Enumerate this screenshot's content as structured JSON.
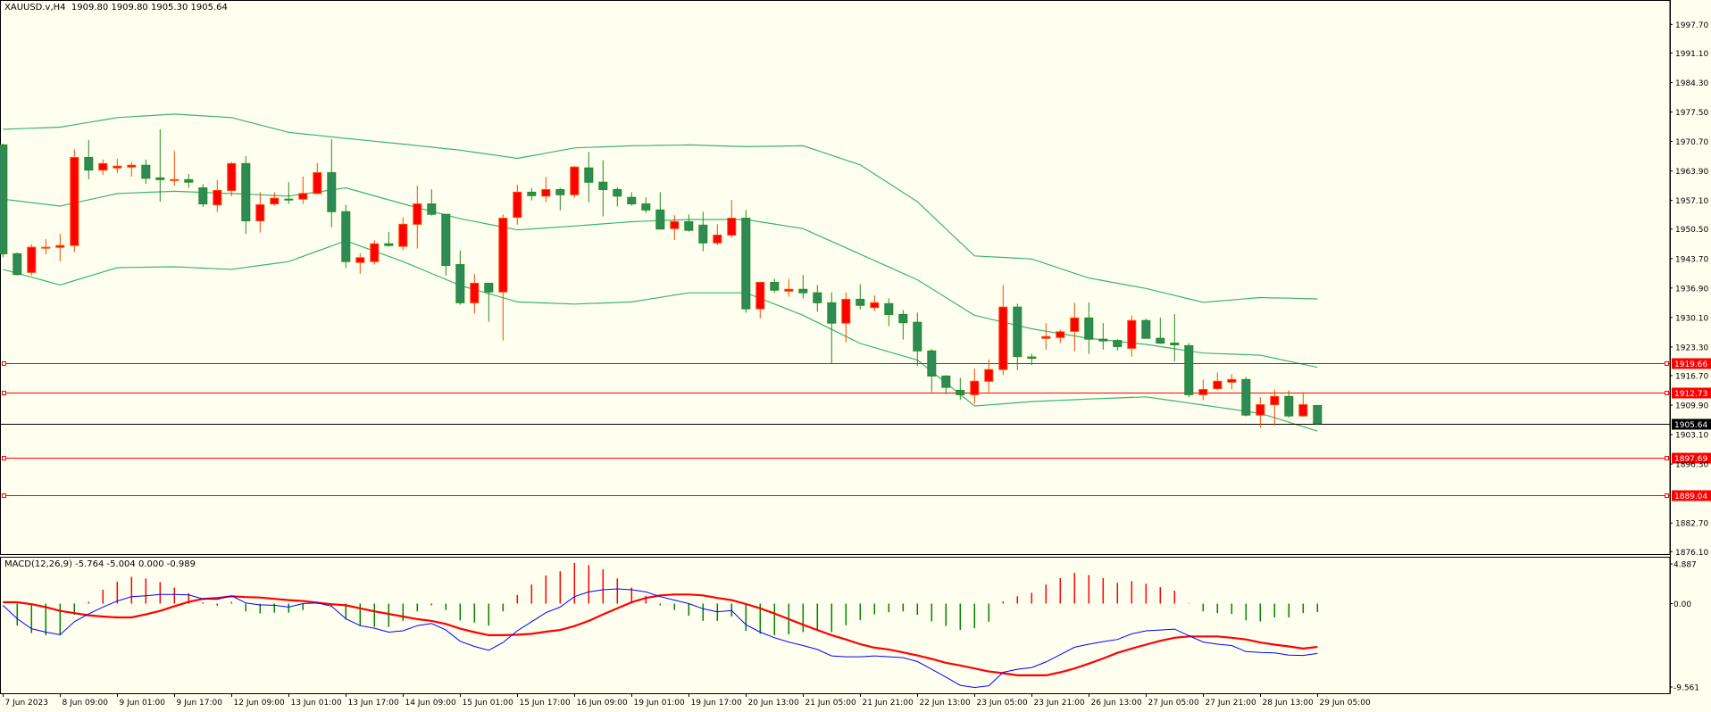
{
  "header": {
    "symbol": "XAUUSD.v,H4",
    "ohlc_text": "1909.80 1909.80 1905.30 1905.64"
  },
  "macd_panel": {
    "label": "MACD(12,26,9) -5.764 -5.004 0.000 -0.989"
  },
  "colors": {
    "background": "#FFFFF0",
    "bull_body": "#FF0000",
    "bull_border": "#FF4500",
    "bear_body": "#2E8B57",
    "bear_border": "#228B22",
    "bands": "#3CB371",
    "hline": "#FF0000",
    "price_line": "#000000",
    "macd_line": "#0000FF",
    "signal_line": "#FF0000",
    "hist_pos": "#FF0000",
    "hist_neg": "#008000"
  },
  "chart_data": [
    {
      "type": "candlestick",
      "title": "XAUUSD.v,H4",
      "timeframe": "H4",
      "ylim": [
        1874.5,
        2002.0
      ],
      "y_ticks": [
        "1997.70",
        "1991.10",
        "1984.30",
        "1977.50",
        "1970.70",
        "1963.90",
        "1957.10",
        "1950.50",
        "1943.70",
        "1936.90",
        "1930.10",
        "1923.30",
        "1916.70",
        "1909.90",
        "1903.10",
        "1896.30",
        "1882.70",
        "1876.10"
      ],
      "x_tick_labels": [
        "7 Jun 2023",
        "8 Jun 09:00",
        "9 Jun 01:00",
        "9 Jun 17:00",
        "12 Jun 09:00",
        "13 Jun 01:00",
        "13 Jun 17:00",
        "14 Jun 09:00",
        "15 Jun 01:00",
        "15 Jun 17:00",
        "16 Jun 09:00",
        "19 Jun 01:00",
        "19 Jun 17:00",
        "20 Jun 13:00",
        "21 Jun 05:00",
        "21 Jun 21:00",
        "22 Jun 13:00",
        "23 Jun 05:00",
        "23 Jun 21:00",
        "26 Jun 13:00",
        "27 Jun 05:00",
        "27 Jun 21:00",
        "28 Jun 13:00",
        "29 Jun 05:00"
      ],
      "x_tick_every_n_bars": 4,
      "ohlc": [
        [
          1969.9,
          1970.2,
          1944.0,
          1944.8
        ],
        [
          1944.8,
          1945.1,
          1939.8,
          1940.0
        ],
        [
          1940.5,
          1947.0,
          1939.8,
          1946.3
        ],
        [
          1946.2,
          1948.2,
          1944.7,
          1946.3
        ],
        [
          1946.3,
          1949.4,
          1943.1,
          1946.7
        ],
        [
          1946.7,
          1968.9,
          1945.2,
          1967.0
        ],
        [
          1967.0,
          1971.0,
          1962.0,
          1964.1
        ],
        [
          1964.1,
          1966.5,
          1963.0,
          1965.6
        ],
        [
          1964.6,
          1966.7,
          1963.4,
          1965.0
        ],
        [
          1964.8,
          1965.9,
          1962.6,
          1965.2
        ],
        [
          1965.2,
          1966.5,
          1960.9,
          1962.2
        ],
        [
          1962.3,
          1973.5,
          1956.8,
          1961.9
        ],
        [
          1961.8,
          1968.5,
          1960.5,
          1961.9
        ],
        [
          1961.9,
          1963.2,
          1960.0,
          1961.3
        ],
        [
          1960.0,
          1960.9,
          1955.6,
          1956.3
        ],
        [
          1956.1,
          1961.8,
          1954.4,
          1959.4
        ],
        [
          1959.4,
          1966.0,
          1958.1,
          1965.6
        ],
        [
          1965.6,
          1967.3,
          1949.4,
          1952.4
        ],
        [
          1952.4,
          1959.0,
          1949.7,
          1956.1
        ],
        [
          1956.3,
          1959.0,
          1955.9,
          1957.6
        ],
        [
          1957.4,
          1961.3,
          1956.3,
          1957.3
        ],
        [
          1957.4,
          1962.6,
          1956.3,
          1958.7
        ],
        [
          1958.7,
          1965.7,
          1958.5,
          1963.5
        ],
        [
          1963.5,
          1971.2,
          1950.9,
          1954.5
        ],
        [
          1954.5,
          1956.1,
          1941.5,
          1943.0
        ],
        [
          1942.8,
          1944.9,
          1940.2,
          1943.9
        ],
        [
          1943.0,
          1947.9,
          1942.3,
          1947.1
        ],
        [
          1947.1,
          1949.8,
          1946.4,
          1946.7
        ],
        [
          1946.5,
          1953.2,
          1945.6,
          1951.6
        ],
        [
          1951.6,
          1960.5,
          1946.0,
          1956.3
        ],
        [
          1956.3,
          1959.7,
          1953.6,
          1953.9
        ],
        [
          1953.9,
          1953.9,
          1939.8,
          1942.1
        ],
        [
          1942.3,
          1945.6,
          1933.0,
          1933.5
        ],
        [
          1933.5,
          1940.1,
          1931.0,
          1938.0
        ],
        [
          1938.0,
          1938.0,
          1929.1,
          1936.0
        ],
        [
          1936.0,
          1953.9,
          1924.8,
          1953.0
        ],
        [
          1953.2,
          1960.7,
          1951.5,
          1959.0
        ],
        [
          1959.0,
          1960.0,
          1957.1,
          1958.2
        ],
        [
          1958.1,
          1962.5,
          1956.7,
          1959.6
        ],
        [
          1959.6,
          1960.0,
          1954.8,
          1958.4
        ],
        [
          1958.4,
          1965.0,
          1957.7,
          1964.8
        ],
        [
          1964.6,
          1968.3,
          1956.7,
          1961.3
        ],
        [
          1961.3,
          1966.4,
          1953.4,
          1959.6
        ],
        [
          1959.6,
          1960.1,
          1955.7,
          1958.1
        ],
        [
          1957.8,
          1959.0,
          1955.9,
          1956.3
        ],
        [
          1956.3,
          1957.8,
          1954.2,
          1954.9
        ],
        [
          1954.9,
          1959.0,
          1950.4,
          1950.5
        ],
        [
          1950.6,
          1953.7,
          1948.0,
          1952.2
        ],
        [
          1952.2,
          1953.9,
          1949.9,
          1950.2
        ],
        [
          1951.4,
          1954.5,
          1945.4,
          1947.3
        ],
        [
          1947.3,
          1951.6,
          1946.8,
          1949.1
        ],
        [
          1949.1,
          1957.2,
          1948.5,
          1953.0
        ],
        [
          1953.0,
          1954.9,
          1931.2,
          1932.1
        ],
        [
          1932.1,
          1938.4,
          1929.9,
          1938.2
        ],
        [
          1938.2,
          1939.0,
          1935.8,
          1936.4
        ],
        [
          1936.2,
          1939.0,
          1934.9,
          1936.6
        ],
        [
          1936.6,
          1939.9,
          1934.5,
          1935.8
        ],
        [
          1935.8,
          1937.6,
          1931.4,
          1933.5
        ],
        [
          1933.5,
          1935.9,
          1919.5,
          1928.8
        ],
        [
          1928.8,
          1935.9,
          1924.4,
          1934.3
        ],
        [
          1934.3,
          1937.8,
          1932.0,
          1932.9
        ],
        [
          1932.4,
          1935.2,
          1931.6,
          1933.5
        ],
        [
          1933.3,
          1934.5,
          1928.1,
          1930.8
        ],
        [
          1930.8,
          1931.8,
          1925.0,
          1928.9
        ],
        [
          1929.0,
          1931.2,
          1918.9,
          1922.4
        ],
        [
          1922.4,
          1922.8,
          1912.9,
          1916.6
        ],
        [
          1916.6,
          1916.8,
          1912.4,
          1914.0
        ],
        [
          1913.3,
          1916.2,
          1911.1,
          1912.3
        ],
        [
          1912.3,
          1918.3,
          1910.2,
          1915.4
        ],
        [
          1915.4,
          1920.4,
          1912.9,
          1918.1
        ],
        [
          1918.1,
          1937.6,
          1916.8,
          1932.5
        ],
        [
          1932.5,
          1933.3,
          1918.0,
          1921.1
        ],
        [
          1921.0,
          1921.8,
          1919.1,
          1920.7
        ],
        [
          1925.3,
          1928.8,
          1922.7,
          1925.7
        ],
        [
          1925.5,
          1927.3,
          1924.2,
          1926.8
        ],
        [
          1926.9,
          1933.5,
          1922.3,
          1930.0
        ],
        [
          1930.0,
          1933.6,
          1921.7,
          1925.1
        ],
        [
          1925.1,
          1928.8,
          1922.7,
          1924.7
        ],
        [
          1924.8,
          1925.1,
          1922.5,
          1923.4
        ],
        [
          1923.0,
          1930.6,
          1921.1,
          1929.4
        ],
        [
          1929.4,
          1929.9,
          1925.3,
          1925.3
        ],
        [
          1925.3,
          1930.1,
          1924.0,
          1924.2
        ],
        [
          1924.2,
          1930.9,
          1920.0,
          1923.8
        ],
        [
          1923.6,
          1924.2,
          1911.7,
          1912.3
        ],
        [
          1912.3,
          1915.8,
          1911.0,
          1913.5
        ],
        [
          1913.7,
          1917.4,
          1913.3,
          1915.4
        ],
        [
          1915.2,
          1917.0,
          1913.5,
          1915.8
        ],
        [
          1915.8,
          1916.4,
          1907.3,
          1907.6
        ],
        [
          1907.6,
          1911.7,
          1904.7,
          1910.0
        ],
        [
          1910.0,
          1913.5,
          1905.2,
          1911.9
        ],
        [
          1911.9,
          1913.3,
          1907.0,
          1907.4
        ],
        [
          1907.4,
          1912.9,
          1907.2,
          1910.0
        ],
        [
          1909.8,
          1909.8,
          1905.3,
          1905.64
        ]
      ],
      "bollinger": {
        "sample_bars": [
          0,
          4,
          8,
          12,
          16,
          20,
          24,
          28,
          32,
          36,
          40,
          44,
          48,
          52,
          56,
          60,
          64,
          68,
          72,
          76,
          80,
          84,
          88,
          92
        ],
        "upper": [
          1973.5,
          1974.0,
          1976.2,
          1977.0,
          1976.2,
          1972.8,
          1971.4,
          1970.1,
          1968.7,
          1966.8,
          1969.2,
          1969.7,
          1969.9,
          1969.5,
          1969.7,
          1965.3,
          1956.8,
          1944.3,
          1943.6,
          1939.2,
          1936.8,
          1933.6,
          1934.7,
          1934.4
        ],
        "middle": [
          1957.4,
          1955.8,
          1958.7,
          1959.2,
          1958.7,
          1958.1,
          1960.0,
          1956.3,
          1952.9,
          1950.3,
          1951.2,
          1952.2,
          1952.7,
          1952.7,
          1950.6,
          1944.7,
          1938.8,
          1930.6,
          1927.5,
          1925.3,
          1923.9,
          1921.9,
          1921.4,
          1918.6
        ],
        "lower": [
          1941.2,
          1937.6,
          1941.6,
          1941.8,
          1941.2,
          1943.0,
          1947.8,
          1943.0,
          1937.5,
          1933.7,
          1933.2,
          1933.7,
          1935.8,
          1935.8,
          1930.6,
          1924.1,
          1920.3,
          1909.7,
          1910.7,
          1911.3,
          1911.8,
          1909.9,
          1908.0,
          1903.9
        ]
      },
      "horizontal_lines": [
        {
          "price": "1919.66",
          "type": "level"
        },
        {
          "price": "1912.73",
          "type": "level"
        },
        {
          "price": "1897.69",
          "type": "level"
        },
        {
          "price": "1889.04",
          "type": "level"
        }
      ],
      "current_price": "1905.64"
    },
    {
      "type": "macd",
      "title": "MACD(12,26,9)",
      "ylim": [
        -9.561,
        4.887
      ],
      "y_ticks": [
        "4.887",
        "0.00",
        "-9.561"
      ],
      "histogram": [
        0,
        -2.55,
        -3.4,
        -3.65,
        -3.65,
        -1.3,
        0.2,
        1.6,
        2.55,
        3.1,
        2.9,
        2.5,
        1.85,
        1.2,
        0.15,
        -0.25,
        0.2,
        -0.9,
        -1.15,
        -1.05,
        -1.05,
        -0.75,
        -0.03,
        -0.4,
        -1.85,
        -2.6,
        -2.7,
        -2.7,
        -2.0,
        -0.9,
        -0.2,
        -0.75,
        -1.95,
        -2.2,
        -2.55,
        -0.9,
        1.0,
        2.2,
        3.25,
        3.75,
        4.7,
        4.45,
        3.95,
        2.9,
        1.85,
        0.9,
        -0.2,
        -0.75,
        -1.4,
        -2.0,
        -2.0,
        -1.5,
        -3.15,
        -3.5,
        -3.65,
        -3.55,
        -3.3,
        -3.15,
        -3.3,
        -2.5,
        -1.9,
        -1.25,
        -1.0,
        -0.9,
        -1.3,
        -2.05,
        -2.6,
        -3.05,
        -2.85,
        -2.1,
        0.25,
        0.85,
        1.25,
        2.2,
        2.95,
        3.55,
        3.3,
        2.95,
        2.4,
        2.6,
        2.3,
        1.9,
        1.5,
        0.05,
        -0.9,
        -1.1,
        -1.2,
        -1.95,
        -2.05,
        -1.6,
        -1.6,
        -1.1,
        -0.989
      ],
      "macd": [
        -0.2,
        -1.75,
        -2.9,
        -3.3,
        -3.6,
        -2.1,
        -1.2,
        -0.4,
        0.3,
        0.8,
        0.9,
        1.05,
        1.05,
        1.0,
        0.55,
        0.5,
        0.9,
        0.07,
        -0.15,
        -0.2,
        -0.4,
        0,
        0.07,
        -0.3,
        -1.75,
        -2.55,
        -2.85,
        -3.3,
        -3.15,
        -2.55,
        -2.3,
        -3.05,
        -4.35,
        -4.95,
        -5.4,
        -4.5,
        -3.15,
        -2.1,
        -1.05,
        -0.4,
        0.8,
        1.35,
        1.6,
        1.7,
        1.6,
        1.35,
        0.8,
        0.4,
        0,
        -0.6,
        -0.95,
        -0.8,
        -2.45,
        -3.3,
        -3.95,
        -4.45,
        -4.85,
        -5.3,
        -6.05,
        -6.15,
        -6.15,
        -6.05,
        -6.15,
        -6.25,
        -6.7,
        -7.6,
        -8.5,
        -9.45,
        -9.7,
        -9.5,
        -7.95,
        -7.6,
        -7.4,
        -6.75,
        -5.9,
        -5.05,
        -4.7,
        -4.4,
        -4.15,
        -3.5,
        -3.15,
        -3.05,
        -2.95,
        -3.7,
        -4.45,
        -4.7,
        -4.85,
        -5.55,
        -5.65,
        -5.7,
        -5.95,
        -6.0,
        -5.764
      ],
      "signal": [
        0.15,
        0.15,
        -0.07,
        -0.4,
        -0.85,
        -1.1,
        -1.35,
        -1.5,
        -1.6,
        -1.6,
        -1.25,
        -0.85,
        -0.3,
        0.2,
        0.55,
        0.65,
        0.85,
        0.75,
        0.7,
        0.55,
        0.4,
        0.3,
        0.1,
        -0.07,
        -0.2,
        -0.55,
        -0.9,
        -1.2,
        -1.5,
        -1.8,
        -2.0,
        -2.35,
        -2.9,
        -3.3,
        -3.65,
        -3.65,
        -3.6,
        -3.5,
        -3.25,
        -3.05,
        -2.6,
        -2.0,
        -1.25,
        -0.55,
        0.15,
        0.65,
        0.95,
        1.05,
        1.05,
        0.95,
        0.65,
        0.4,
        -0.05,
        -0.55,
        -1.15,
        -1.8,
        -2.45,
        -3.05,
        -3.65,
        -4.15,
        -4.7,
        -5.1,
        -5.3,
        -5.65,
        -6.0,
        -6.4,
        -6.85,
        -7.15,
        -7.5,
        -7.85,
        -8.05,
        -8.3,
        -8.3,
        -8.3,
        -7.95,
        -7.5,
        -6.95,
        -6.35,
        -5.7,
        -5.2,
        -4.75,
        -4.3,
        -3.95,
        -3.8,
        -3.8,
        -3.8,
        -3.95,
        -4.15,
        -4.5,
        -4.75,
        -4.95,
        -5.2,
        -5.004
      ]
    }
  ]
}
